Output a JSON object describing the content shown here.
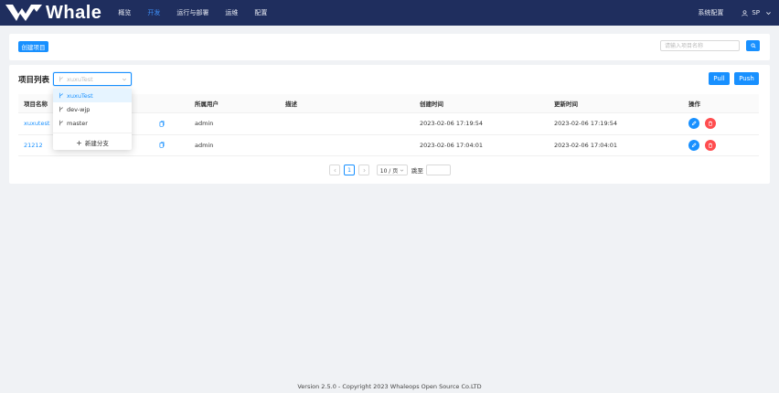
{
  "app": {
    "logo_text": "Whale"
  },
  "nav": {
    "items": [
      {
        "label": "概览",
        "active": false
      },
      {
        "label": "开发",
        "active": true
      },
      {
        "label": "运行与部署",
        "active": false
      },
      {
        "label": "运维",
        "active": false
      },
      {
        "label": "配置",
        "active": false
      }
    ],
    "system_config": "系统配置",
    "user": "SP"
  },
  "toolbar": {
    "create_label": "创建项目",
    "search_placeholder": "请输入项目名称"
  },
  "list": {
    "title": "项目列表",
    "branch_select_value": "xuxuTest",
    "pull_label": "Pull",
    "push_label": "Push",
    "columns": [
      "项目名称",
      "所属用户",
      "描述",
      "创建时间",
      "更新时间",
      "操作"
    ],
    "rows": [
      {
        "name": "xuxutest",
        "user": "admin",
        "desc": "",
        "created": "2023-02-06 17:19:54",
        "updated": "2023-02-06 17:19:54"
      },
      {
        "name": "21212",
        "user": "admin",
        "desc": "",
        "created": "2023-02-06 17:04:01",
        "updated": "2023-02-06 17:04:01"
      }
    ]
  },
  "pagination": {
    "current_page": "1",
    "page_size": "10 / 页",
    "jump_label": "跳至"
  },
  "branch_dropdown": {
    "items": [
      {
        "label": "xuxuTest",
        "selected": true
      },
      {
        "label": "dev-wjp",
        "selected": false
      },
      {
        "label": "master",
        "selected": false
      }
    ],
    "new_branch_label": "新建分支"
  },
  "footer": "Version 2.5.0 - Copyright 2023 Whaleops Open Source Co.LTD",
  "colors": {
    "nav_bg": "#1f2e5e",
    "primary": "#1890ff",
    "danger": "#ff4d4f",
    "nav_active": "#3e8ef7"
  }
}
